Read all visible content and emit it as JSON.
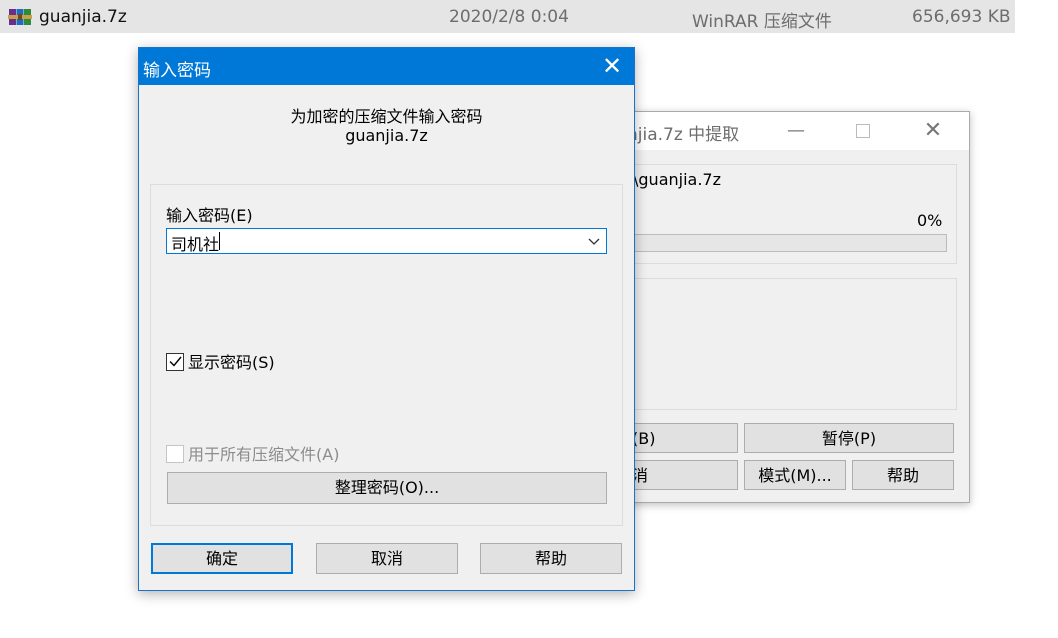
{
  "explorer_row": {
    "file_name": "guanjia.7z",
    "date": "2020/2/8 0:04",
    "type": "WinRAR 压缩文件",
    "size": "656,693 KB",
    "icon": "winrar-archive-icon"
  },
  "extract_window": {
    "title": "njia.7z 中提取",
    "file_path": "\\guanjia.7z",
    "percent": "0%",
    "progress": 0,
    "buttons": {
      "background": "(B)",
      "pause": "暂停(P)",
      "cancel": "消",
      "mode": "模式(M)...",
      "help": "帮助"
    }
  },
  "password_dialog": {
    "title": "输入密码",
    "heading": "为加密的压缩文件输入密码",
    "file_name": "guanjia.7z",
    "field_label": "输入密码(E)",
    "password_value": "司机社",
    "show_password_label": "显示密码(S)",
    "show_password_checked": true,
    "all_archives_label": "用于所有压缩文件(A)",
    "all_archives_checked": false,
    "organize_button": "整理密码(O)...",
    "ok_button": "确定",
    "cancel_button": "取消",
    "help_button": "帮助"
  },
  "colors": {
    "accent": "#0078d7",
    "dialog_bg": "#f0f0f0",
    "progress_fill": "#06b025"
  }
}
